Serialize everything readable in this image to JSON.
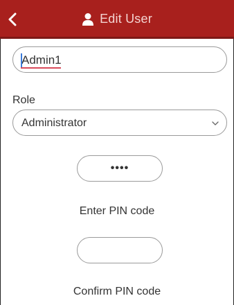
{
  "header": {
    "title": "Edit User",
    "back_icon": "chevron-left-icon",
    "user_icon": "user-icon",
    "background": "#a8201d"
  },
  "user_name": {
    "value": "Admin1"
  },
  "role": {
    "label": "Role",
    "selected": "Administrator",
    "chevron_icon": "chevron-down-icon"
  },
  "pin": {
    "masked_value": "••••",
    "label": "Enter PIN code"
  },
  "confirm_pin": {
    "value": "",
    "label": "Confirm PIN code"
  }
}
